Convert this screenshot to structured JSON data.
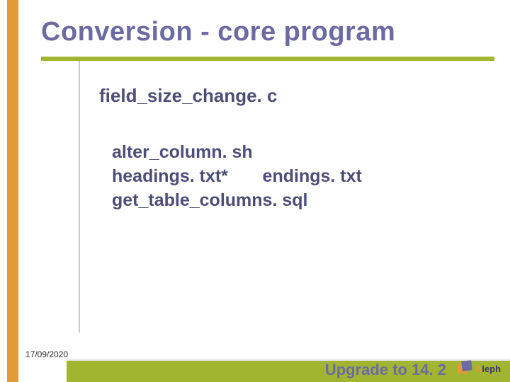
{
  "slide": {
    "title": "Conversion - core program",
    "section_heading": "field_size_change. c",
    "files": {
      "line1": "alter_column. sh",
      "line2a": "headings. txt*",
      "line2b": "endings. txt",
      "line3": "get_table_columns. sql"
    }
  },
  "footer": {
    "date": "17/09/2020",
    "caption": "Upgrade to 14. 2",
    "logo_text_a": "A",
    "logo_text_rest": "leph"
  },
  "colors": {
    "accent_orange": "#e39a37",
    "accent_olive": "#a2b531",
    "text_purple": "#6c6aa2"
  }
}
